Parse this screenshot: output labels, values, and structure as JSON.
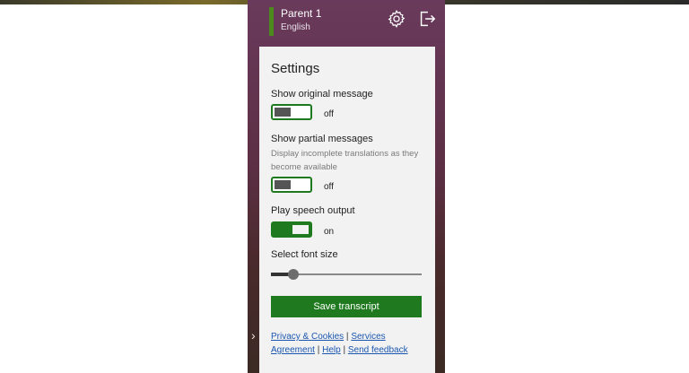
{
  "header": {
    "user_name": "Parent 1",
    "language": "English",
    "icons": [
      "gear-icon",
      "logout-icon"
    ]
  },
  "settings": {
    "title": "Settings",
    "show_original": {
      "label": "Show original message",
      "state": "off"
    },
    "show_partial": {
      "label": "Show partial messages",
      "description": "Display incomplete translations as they become available",
      "state": "off"
    },
    "play_speech": {
      "label": "Play speech output",
      "state": "on"
    },
    "font_size": {
      "label": "Select font size",
      "value_fraction": 0.15
    },
    "save_label": "Save transcript"
  },
  "footer": {
    "privacy": "Privacy & Cookies",
    "sep1": "|",
    "services": "Services Agreement",
    "sep2": "|",
    "help": "Help",
    "sep3": "|",
    "feedback": "Send feedback"
  },
  "colors": {
    "accent_green": "#1f7a1f",
    "user_bar": "#4d8a1e",
    "link": "#1a56b0"
  }
}
